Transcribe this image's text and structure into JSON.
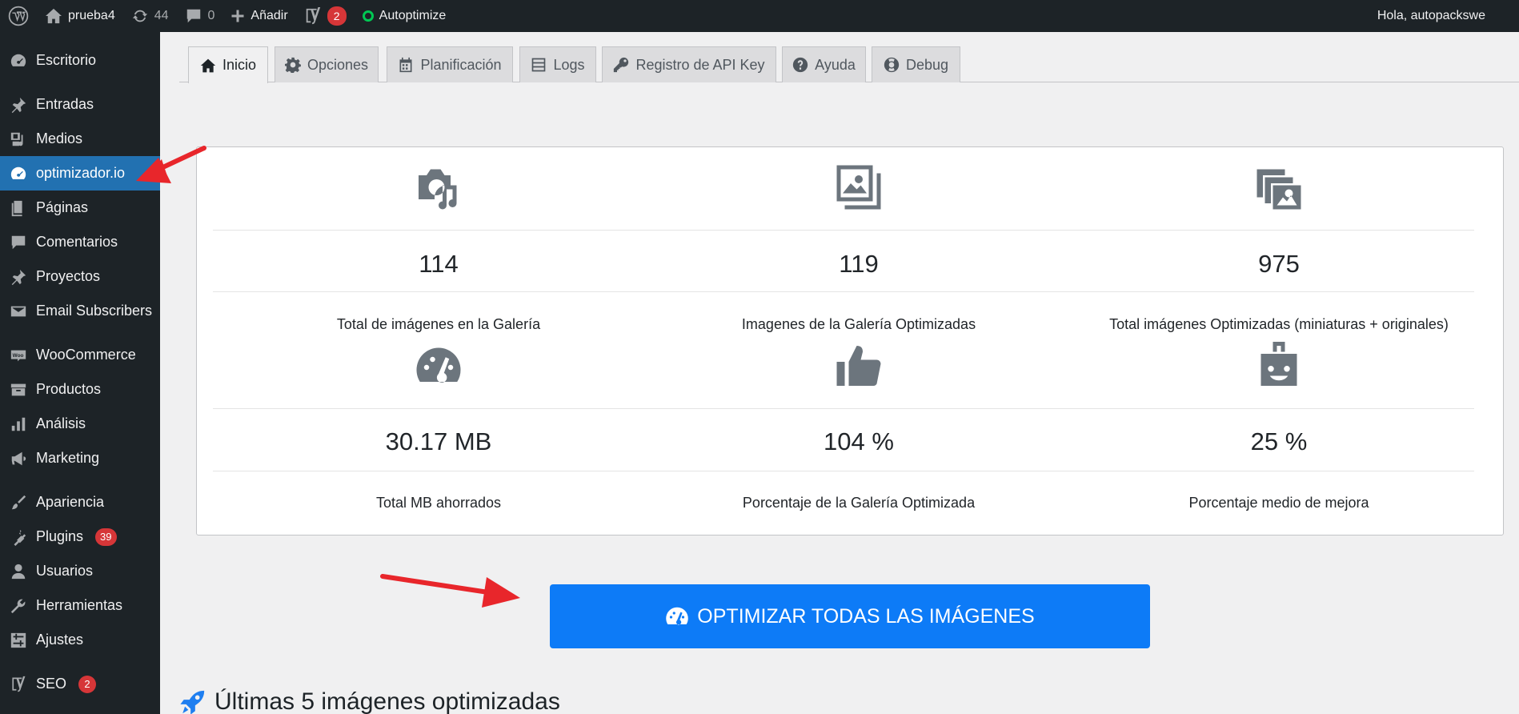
{
  "adminbar": {
    "site_name": "prueba4",
    "updates_count": "44",
    "comments_count": "0",
    "add_new_label": "Añadir",
    "yoast_badge": "2",
    "autoptimize_label": "Autoptimize",
    "greeting": "Hola, autopackswe"
  },
  "sidebar": {
    "items": [
      {
        "label": "Escritorio",
        "icon": "dashboard-icon"
      },
      {
        "label": "Entradas",
        "icon": "pin-icon"
      },
      {
        "label": "Medios",
        "icon": "media-icon"
      },
      {
        "label": "optimizador.io",
        "icon": "gauge-icon",
        "active": true
      },
      {
        "label": "Páginas",
        "icon": "pages-icon"
      },
      {
        "label": "Comentarios",
        "icon": "comment-icon"
      },
      {
        "label": "Proyectos",
        "icon": "pin-icon"
      },
      {
        "label": "Email Subscribers",
        "icon": "envelope-icon"
      },
      {
        "label": "WooCommerce",
        "icon": "woo-icon"
      },
      {
        "label": "Productos",
        "icon": "archive-icon"
      },
      {
        "label": "Análisis",
        "icon": "bar-chart-icon"
      },
      {
        "label": "Marketing",
        "icon": "megaphone-icon"
      },
      {
        "label": "Apariencia",
        "icon": "brush-icon"
      },
      {
        "label": "Plugins",
        "icon": "plug-icon",
        "badge": "39"
      },
      {
        "label": "Usuarios",
        "icon": "user-icon"
      },
      {
        "label": "Herramientas",
        "icon": "wrench-icon"
      },
      {
        "label": "Ajustes",
        "icon": "sliders-icon"
      },
      {
        "label": "SEO",
        "icon": "yoast-icon",
        "badge": "2"
      }
    ]
  },
  "tabs": [
    {
      "label": "Inicio",
      "icon": "home-icon",
      "active": true
    },
    {
      "label": "Opciones",
      "icon": "gear-icon"
    },
    {
      "label": "Planificación",
      "icon": "calendar-icon"
    },
    {
      "label": "Logs",
      "icon": "list-icon"
    },
    {
      "label": "Registro de API Key",
      "icon": "key-icon"
    },
    {
      "label": "Ayuda",
      "icon": "question-icon"
    },
    {
      "label": "Debug",
      "icon": "lifebuoy-icon"
    }
  ],
  "stats": [
    {
      "value": "114",
      "label": "Total de imágenes en la Galería",
      "icon": "camera-music-icon"
    },
    {
      "value": "119",
      "label": "Imagenes de la Galería Optimizadas",
      "icon": "images-icon"
    },
    {
      "value": "975",
      "label": "Total imágenes Optimizadas (miniaturas + originales)",
      "icon": "photo-stack-icon"
    },
    {
      "value": "30.17 MB",
      "label": "Total MB ahorrados",
      "icon": "tachometer-icon"
    },
    {
      "value": "104 %",
      "label": "Porcentaje de la Galería Optimizada",
      "icon": "thumbs-up-icon"
    },
    {
      "value": "25 %",
      "label": "Porcentaje medio de mejora",
      "icon": "id-badge-icon"
    }
  ],
  "optimize_button_label": "OPTIMIZAR TODAS LAS IMÁGENES",
  "last_optimized_title": "Últimas 5 imágenes optimizadas",
  "colors": {
    "adminbar_bg": "#1d2327",
    "menu_active": "#2271b1",
    "button_blue": "#0d7bf7",
    "badge_red": "#d63638",
    "arrow_red": "#e8262b",
    "icon_gray": "#6c757d"
  }
}
